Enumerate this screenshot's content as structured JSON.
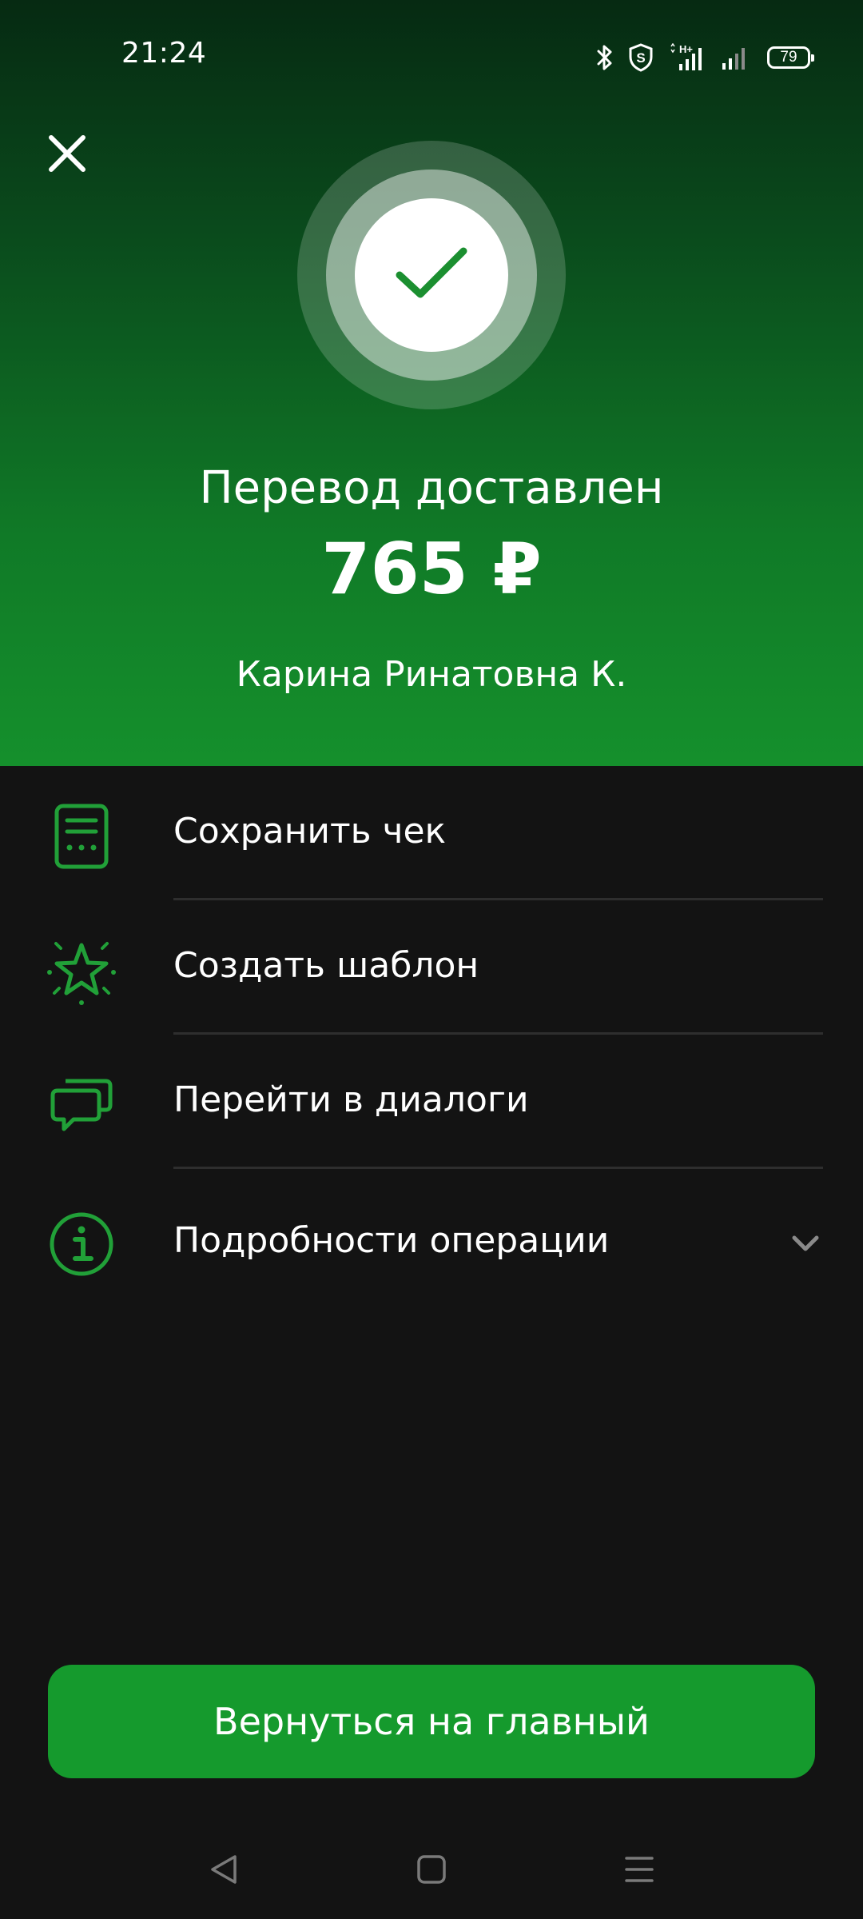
{
  "status_bar": {
    "time": "21:24",
    "battery": "79",
    "network": "H+",
    "icons": [
      "bluetooth-icon",
      "shield-icon",
      "network-type-icon",
      "signal-icon",
      "signal-weak-icon",
      "battery-icon"
    ]
  },
  "header": {
    "close_icon": "close-icon",
    "success_icon": "checkmark-icon",
    "title": "Перевод доставлен",
    "amount": "765 ₽",
    "recipient": "Карина Ринатовна К."
  },
  "actions": [
    {
      "label": "Сохранить чек",
      "icon": "receipt-icon"
    },
    {
      "label": "Создать шаблон",
      "icon": "star-icon"
    },
    {
      "label": "Перейти в диалоги",
      "icon": "chat-icon"
    },
    {
      "label": "Подробности операции",
      "icon": "info-icon",
      "expand_icon": "chevron-down-icon"
    }
  ],
  "main_button": {
    "label": "Вернуться на главный"
  },
  "nav_bar": {
    "items": [
      "back-icon",
      "home-icon",
      "menu-icon"
    ]
  },
  "colors": {
    "accent": "#159a2d",
    "icon_green": "#21a038",
    "background": "#131313",
    "header_top": "#062a12",
    "header_bottom": "#15902c"
  }
}
